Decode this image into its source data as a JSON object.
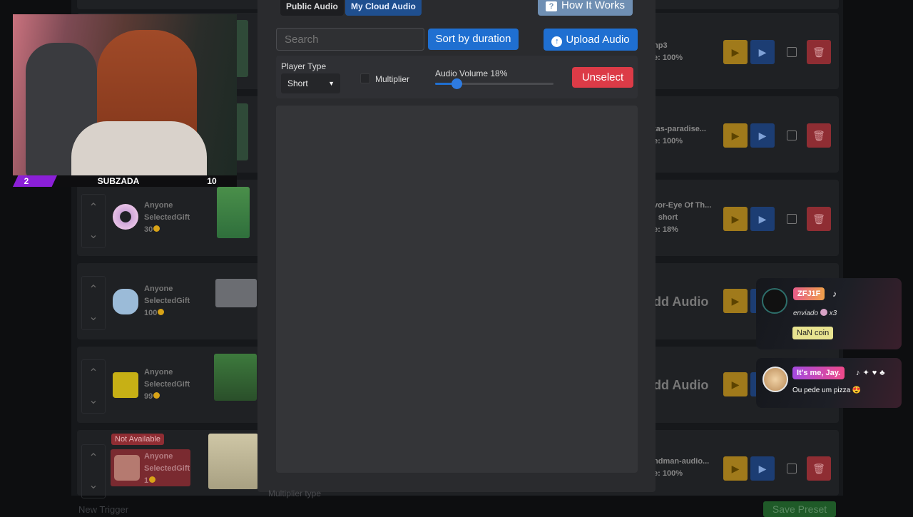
{
  "background_list": {
    "left_rows": [
      {
        "who": "Anyone",
        "gift": "SelectedGift",
        "coins": "30"
      },
      {
        "who": "Anyone",
        "gift": "SelectedGift",
        "coins": "100"
      },
      {
        "who": "Anyone",
        "gift": "SelectedGift",
        "coins": "99"
      },
      {
        "who": "Anyone",
        "gift": "SelectedGift",
        "coins": "1",
        "badge": "Not Available"
      }
    ],
    "right_rows": [
      {
        "name": "np3",
        "info": "e: 100%"
      },
      {
        "name": "tas-paradise...",
        "info": "e: 100%"
      },
      {
        "name": "vor-Eye Of Th...",
        "info": ": short",
        "info2": "e: 18%"
      },
      {
        "name": "dd Audio"
      },
      {
        "name": "dd Audio"
      },
      {
        "name": "ndman-audio...",
        "info": "e: 100%"
      }
    ],
    "new_trigger_label": "New Trigger",
    "save_preset_label": "Save Preset",
    "multiplier_type_label": "Multiplier type"
  },
  "stream_overlay": {
    "left_count": "2",
    "streamer": "SUBZADA",
    "right_count": "10"
  },
  "modal": {
    "tabs": [
      {
        "label": "Public Audio"
      },
      {
        "label": "My Cloud Audio"
      }
    ],
    "how_it_works_label": "How It Works",
    "search_placeholder": "Search",
    "sort_label": "Sort by duration",
    "upload_label": "Upload Audio",
    "player_type_label": "Player Type",
    "player_type_value": "Short",
    "multiplier_label": "Multiplier",
    "volume_label": "Audio Volume 18%",
    "volume_fraction": 0.18,
    "unselect_label": "Unselect"
  },
  "popups": [
    {
      "name_pill": "ZFJ1F",
      "action": "enviado",
      "count": "x3",
      "coin": "NaN coin"
    },
    {
      "name_pill": "It's me, Jay.",
      "message": "Ou pede um pizza 😍"
    }
  ],
  "colors": {
    "blue": "#1f6fd1",
    "red": "#dc3b47",
    "yellow": "#a07a1b",
    "purple": "#8b1fd8"
  }
}
